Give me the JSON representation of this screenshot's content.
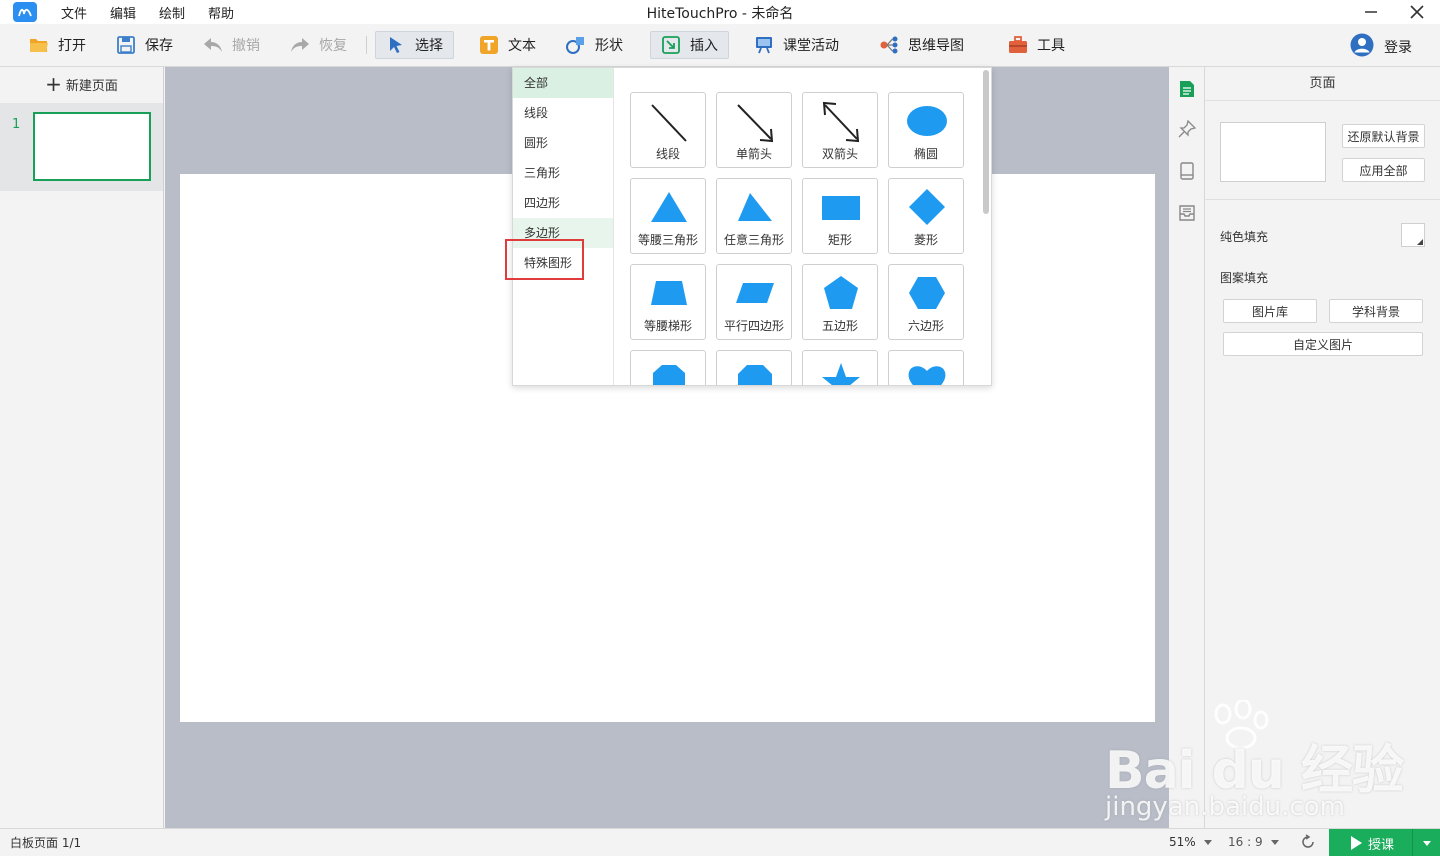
{
  "app": {
    "title": "HiteTouchPro - 未命名",
    "menu": [
      "文件",
      "编辑",
      "绘制",
      "帮助"
    ]
  },
  "toolbar": {
    "open": "打开",
    "save": "保存",
    "undo": "撤销",
    "redo": "恢复",
    "select": "选择",
    "text": "文本",
    "shape": "形状",
    "insert": "插入",
    "classroom": "课堂活动",
    "mindmap": "思维导图",
    "tools": "工具",
    "login": "登录"
  },
  "left_panel": {
    "new_page": "新建页面",
    "page_number": "1"
  },
  "shape_menu": {
    "categories": [
      "全部",
      "线段",
      "圆形",
      "三角形",
      "四边形",
      "多边形",
      "特殊图形"
    ],
    "active_category": "全部",
    "highlighted_category": "特殊图形",
    "shape_color": "#1e9bf0",
    "shapes": [
      "线段",
      "单箭头",
      "双箭头",
      "椭圆",
      "等腰三角形",
      "任意三角形",
      "矩形",
      "菱形",
      "等腰梯形",
      "平行四边形",
      "五边形",
      "六边形"
    ]
  },
  "right_panel": {
    "title": "页面",
    "reset_bg": "还原默认背景",
    "apply_all": "应用全部",
    "solid_fill": "纯色填充",
    "pattern_fill": "图案填充",
    "gallery": "图片库",
    "subject_bg": "学科背景",
    "custom_image": "自定义图片"
  },
  "status": {
    "page_info": "白板页面 1/1",
    "zoom": "51%",
    "ratio": "16 : 9",
    "teach": "授课"
  },
  "watermark": {
    "big": "Bai du 经验",
    "small": "jingyan.baidu.com"
  },
  "colors": {
    "accent_green": "#1aad5b",
    "shape_blue": "#1e9bf0",
    "highlight_red": "#e03c3c"
  }
}
